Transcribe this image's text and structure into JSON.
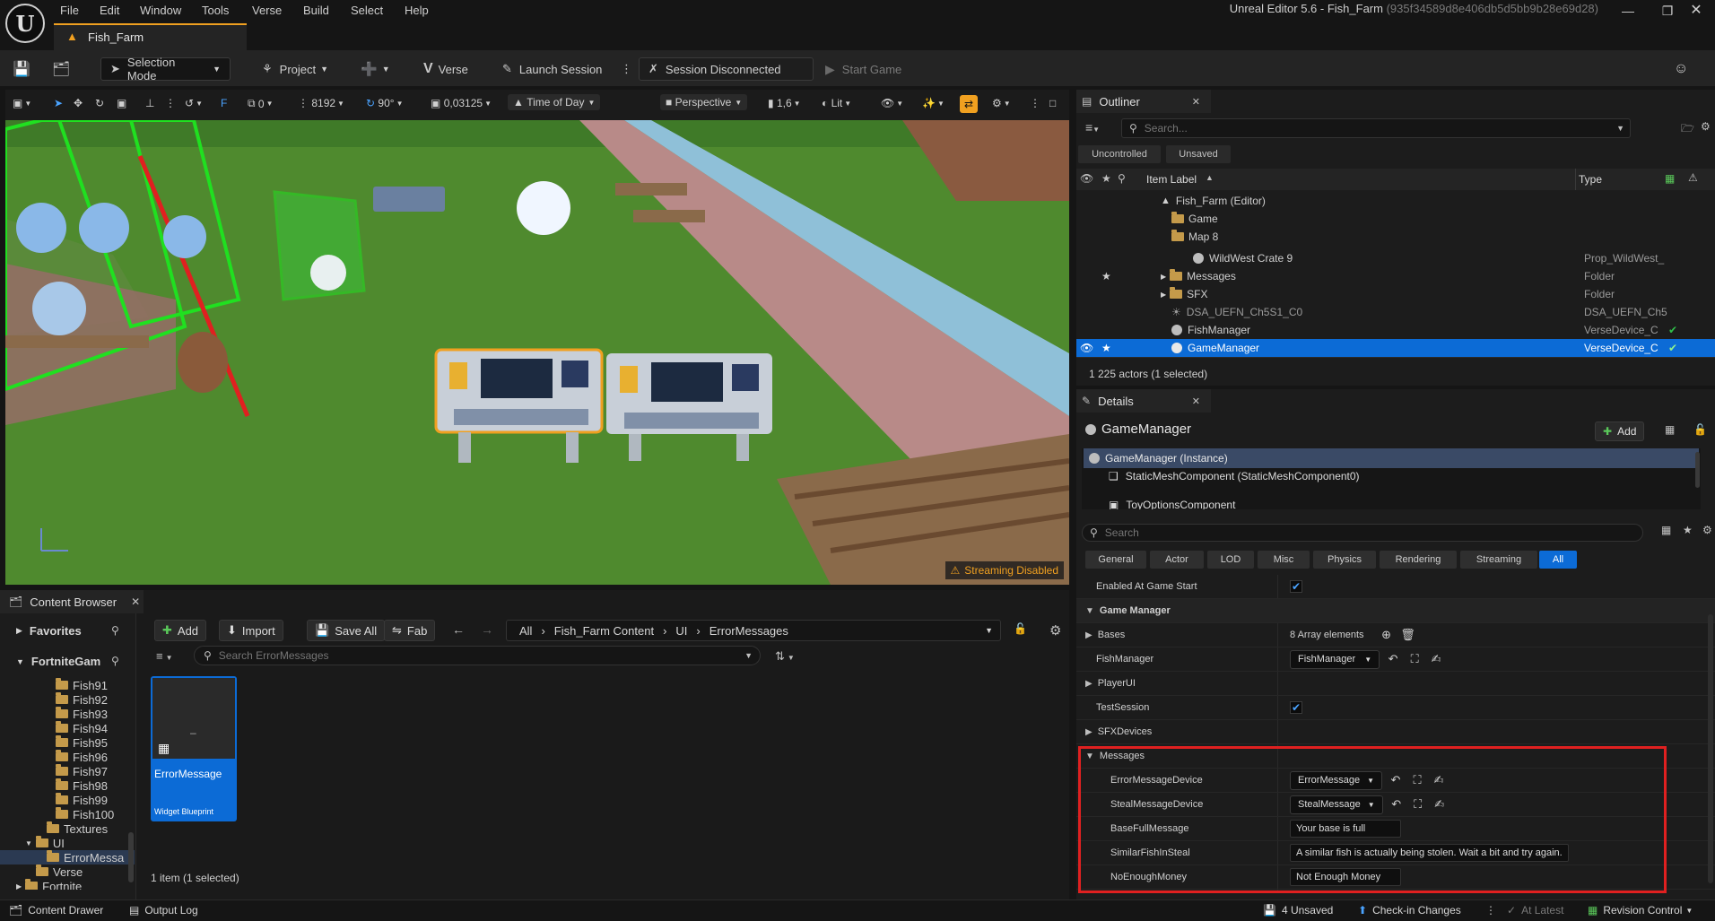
{
  "menubar": {
    "items": [
      "File",
      "Edit",
      "Window",
      "Tools",
      "Verse",
      "Build",
      "Select",
      "Help"
    ],
    "window_title": "Unreal Editor 5.6 - Fish_Farm",
    "window_hash": "(935f34589d8e406db5d5bb9b28e69d28)"
  },
  "doc_tab": {
    "label": "Fish_Farm"
  },
  "toolbar": {
    "selection_mode": "Selection Mode",
    "project": "Project",
    "verse": "Verse",
    "launch_session": "Launch Session",
    "session_status": "Session Disconnected",
    "start_game": "Start Game"
  },
  "viewport_toolbar": {
    "grid": "0",
    "grid_size": "8192",
    "rotation": "90°",
    "scale": "0,03125",
    "time_of_day": "Time of Day",
    "perspective": "Perspective",
    "camera_speed": "1,6",
    "lit": "Lit",
    "streaming_warning": "Streaming Disabled"
  },
  "content_browser": {
    "tab_label": "Content Browser",
    "favorites": "Favorites",
    "root": "FortniteGam",
    "add": "Add",
    "import": "Import",
    "save_all": "Save All",
    "fab": "Fab",
    "breadcrumb": [
      "All",
      "Fish_Farm Content",
      "UI",
      "ErrorMessages"
    ],
    "search_placeholder": "Search ErrorMessages",
    "folders": [
      "Fish91",
      "Fish92",
      "Fish93",
      "Fish94",
      "Fish95",
      "Fish96",
      "Fish97",
      "Fish98",
      "Fish99",
      "Fish100",
      "Textures",
      "UI",
      "ErrorMessa",
      "Verse",
      "Fortnite"
    ],
    "asset": {
      "name": "ErrorMessage",
      "type": "Widget Blueprint"
    },
    "status": "1 item (1 selected)"
  },
  "outliner": {
    "tab_label": "Outliner",
    "search_placeholder": "Search...",
    "filters": [
      "Uncontrolled",
      "Unsaved"
    ],
    "col_label": "Item Label",
    "col_type": "Type",
    "rows": [
      {
        "label": "Fish_Farm (Editor)",
        "type": ""
      },
      {
        "label": "Game",
        "type": ""
      },
      {
        "label": "Map 8",
        "type": ""
      },
      {
        "label": "WildWest Crate 9",
        "type": "Prop_WildWest_"
      },
      {
        "label": "Messages",
        "type": "Folder"
      },
      {
        "label": "SFX",
        "type": "Folder"
      },
      {
        "label": "DSA_UEFN_Ch5S1_C0",
        "type": "DSA_UEFN_Ch5"
      },
      {
        "label": "FishManager",
        "type": "VerseDevice_C"
      },
      {
        "label": "GameManager",
        "type": "VerseDevice_C"
      }
    ],
    "status": "1 225 actors (1 selected)"
  },
  "details": {
    "tab_label": "Details",
    "object_name": "GameManager",
    "add": "Add",
    "components": [
      "GameManager (Instance)",
      "StaticMeshComponent (StaticMeshComponent0)",
      "ToyOptionsComponent"
    ],
    "search_placeholder": "Search",
    "filter_tabs": [
      "General",
      "Actor",
      "LOD",
      "Misc",
      "Physics",
      "Rendering",
      "Streaming",
      "All"
    ],
    "props": {
      "enabled_at_start": "Enabled At Game Start",
      "cat_game_manager": "Game Manager",
      "bases": "Bases",
      "bases_value": "8 Array elements",
      "fish_manager": "FishManager",
      "fish_manager_value": "FishManager",
      "player_ui": "PlayerUI",
      "test_session": "TestSession",
      "sfx_devices": "SFXDevices",
      "cat_messages": "Messages",
      "error_device": "ErrorMessageDevice",
      "error_device_value": "ErrorMessage",
      "steal_device": "StealMessageDevice",
      "steal_device_value": "StealMessage",
      "base_full": "BaseFullMessage",
      "base_full_value": "Your base is full",
      "similar_fish": "SimilarFishInSteal",
      "similar_fish_value": "A similar fish is actually being stolen. Wait a bit and try again.",
      "no_money": "NoEnoughMoney",
      "no_money_value": "Not Enough Money"
    }
  },
  "statusbar": {
    "content_drawer": "Content Drawer",
    "output_log": "Output Log",
    "unsaved": "4 Unsaved",
    "checkin": "Check-in Changes",
    "at_latest": "At Latest",
    "revision": "Revision Control"
  },
  "colors": {
    "selection": "#0c6bd6",
    "accent": "#f0a020",
    "highlight_box": "#e02020",
    "check": "#2fbf4a"
  }
}
